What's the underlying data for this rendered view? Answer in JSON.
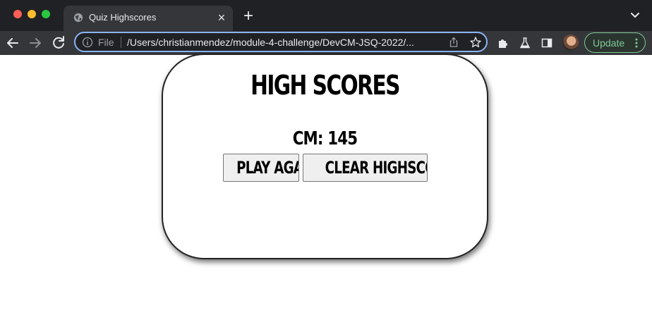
{
  "browser": {
    "tab": {
      "title": "Quiz Highscores",
      "close_glyph": "×",
      "icon": "globe-icon"
    },
    "new_tab_glyph": "+",
    "omnibox": {
      "scheme_label": "File",
      "url": "/Users/christianmendez/module-4-challenge/DevCM-JSQ-2022/..."
    },
    "update_label": "Update",
    "colors": {
      "accent": "#8ab4f8",
      "update": "#81c995",
      "chrome_bg": "#202124",
      "toolbar_bg": "#35363a"
    }
  },
  "page": {
    "heading": "HIGH SCORES",
    "scores": [
      {
        "initials": "CM",
        "score": 145,
        "text": "CM: 145"
      }
    ],
    "buttons": {
      "play_again": "PLAY AGAIN",
      "clear": "CLEAR HIGHSCORES"
    }
  }
}
